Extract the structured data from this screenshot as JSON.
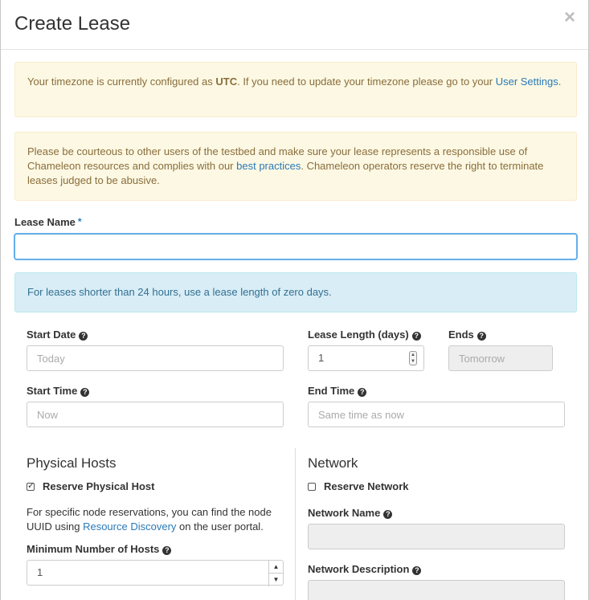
{
  "dialog": {
    "title": "Create Lease",
    "close_symbol": "×"
  },
  "alerts": {
    "timezone": {
      "prefix": "Your timezone is currently configured as ",
      "tz": "UTC",
      "middle": ". If you need to update your timezone please go to your ",
      "link": "User Settings",
      "suffix": "."
    },
    "courtesy": {
      "prefix": "Please be courteous to other users of the testbed and make sure your lease represents a responsible use of Chameleon resources and complies with our ",
      "link": "best practices",
      "suffix": ". Chameleon operators reserve the right to terminate leases judged to be abusive."
    }
  },
  "lease_name": {
    "label": "Lease Name",
    "required_mark": "*",
    "value": ""
  },
  "info_message": "For leases shorter than 24 hours, use a lease length of zero days.",
  "start_date": {
    "label": "Start Date",
    "placeholder": "Today"
  },
  "lease_length": {
    "label": "Lease Length (days)",
    "value": "1"
  },
  "ends": {
    "label": "Ends",
    "placeholder": "Tomorrow"
  },
  "start_time": {
    "label": "Start Time",
    "placeholder": "Now"
  },
  "end_time": {
    "label": "End Time",
    "placeholder": "Same time as now"
  },
  "help_symbol": "?",
  "physical_hosts": {
    "title": "Physical Hosts",
    "reserve_label": "Reserve Physical Host",
    "reserve_checked": true,
    "note_prefix": "For specific node reservations, you can find the node UUID using ",
    "note_link": "Resource Discovery",
    "note_suffix": " on the user portal.",
    "min_hosts_label": "Minimum Number of Hosts",
    "min_hosts_value": "1"
  },
  "network": {
    "title": "Network",
    "reserve_label": "Reserve Network",
    "reserve_checked": false,
    "name_label": "Network Name",
    "name_value": "",
    "description_label": "Network Description"
  },
  "colors": {
    "warning_bg": "#fcf8e3",
    "warning_text": "#8a6d3b",
    "info_bg": "#d9edf7",
    "info_text": "#31708f",
    "link": "#2a7ab8",
    "focus_border": "#66afe9"
  }
}
